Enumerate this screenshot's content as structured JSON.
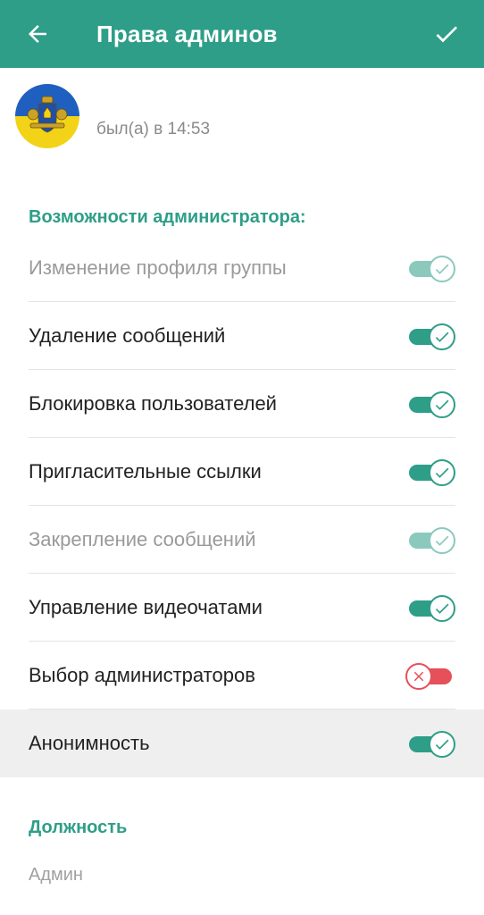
{
  "appbar": {
    "title": "Права админов"
  },
  "user": {
    "name": "",
    "status": "был(а) в 14:53"
  },
  "sections": {
    "permissions_header": "Возможности администратора:",
    "role_header": "Должность"
  },
  "permissions": [
    {
      "label": "Изменение профиля группы",
      "enabled": true,
      "disabled": true
    },
    {
      "label": "Удаление сообщений",
      "enabled": true,
      "disabled": false
    },
    {
      "label": "Блокировка пользователей",
      "enabled": true,
      "disabled": false
    },
    {
      "label": "Пригласительные ссылки",
      "enabled": true,
      "disabled": false
    },
    {
      "label": "Закрепление сообщений",
      "enabled": true,
      "disabled": true
    },
    {
      "label": "Управление видеочатами",
      "enabled": true,
      "disabled": false
    },
    {
      "label": "Выбор администраторов",
      "enabled": false,
      "disabled": false
    },
    {
      "label": "Анонимность",
      "enabled": true,
      "disabled": false
    }
  ],
  "role": {
    "value": "Админ"
  },
  "colors": {
    "accent": "#2e9e88",
    "danger": "#e5505a"
  },
  "icons": {
    "back": "arrow-left-icon",
    "done": "check-icon",
    "on": "check-icon",
    "off": "close-icon"
  }
}
